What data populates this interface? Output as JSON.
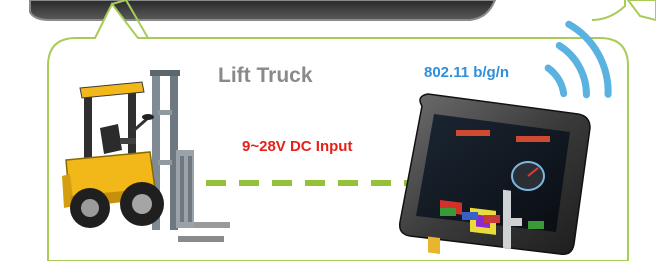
{
  "diagram": {
    "device_label": "Lift Truck",
    "power_label": "9~28V DC Input",
    "wireless_label": "802.11 b/g/n"
  },
  "colors": {
    "callout_border": "#a8cc58",
    "connector": "#94c03a",
    "wifi": "#5ab2e0",
    "power_text": "#e8201a",
    "wifi_text": "#2f8fd8",
    "title_text": "#8a8a8a"
  },
  "icons": [
    "forklift-illustration",
    "tablet-panel-pc",
    "wifi-waves-icon"
  ]
}
